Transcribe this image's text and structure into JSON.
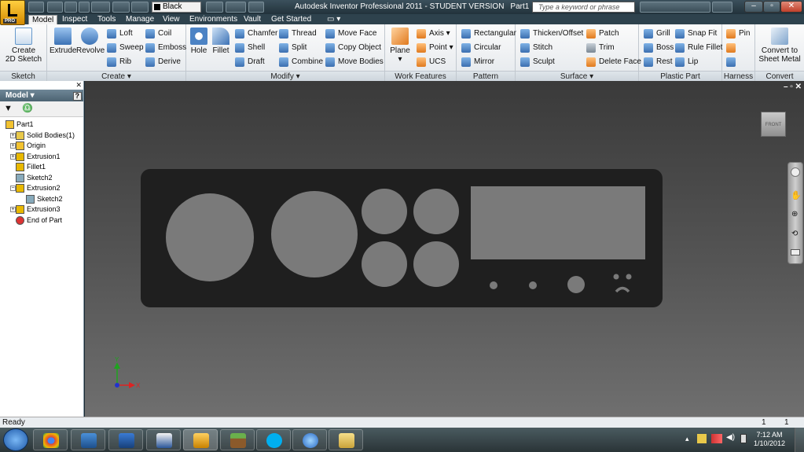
{
  "window": {
    "title": "Autodesk Inventor Professional 2011 - STUDENT VERSION",
    "document": "Part1",
    "app_badge": "PRO",
    "material": "Black",
    "search_placeholder": "Type a keyword or phrase"
  },
  "tabs": [
    "Model",
    "Inspect",
    "Tools",
    "Manage",
    "View",
    "Environments",
    "Vault",
    "Get Started"
  ],
  "ribbon": {
    "sketch": {
      "label": "Sketch",
      "create_line1": "Create",
      "create_line2": "2D Sketch"
    },
    "create": {
      "label": "Create",
      "extrude": "Extrude",
      "revolve": "Revolve",
      "loft": "Loft",
      "sweep": "Sweep",
      "rib": "Rib",
      "coil": "Coil",
      "emboss": "Emboss",
      "derive": "Derive"
    },
    "modify": {
      "label": "Modify",
      "hole": "Hole",
      "fillet": "Fillet",
      "chamfer": "Chamfer",
      "shell": "Shell",
      "draft": "Draft",
      "thread": "Thread",
      "split": "Split",
      "combine": "Combine",
      "move_face": "Move Face",
      "copy_object": "Copy Object",
      "move_bodies": "Move Bodies"
    },
    "work_features": {
      "label": "Work Features",
      "plane": "Plane",
      "axis": "Axis",
      "point": "Point",
      "ucs": "UCS"
    },
    "pattern": {
      "label": "Pattern",
      "rectangular": "Rectangular",
      "circular": "Circular",
      "mirror": "Mirror"
    },
    "surface": {
      "label": "Surface",
      "thicken": "Thicken/Offset",
      "stitch": "Stitch",
      "sculpt": "Sculpt",
      "patch": "Patch",
      "trim": "Trim",
      "delete_face": "Delete Face"
    },
    "plastic": {
      "label": "Plastic Part",
      "grill": "Grill",
      "boss": "Boss",
      "rest": "Rest",
      "snap_fit": "Snap Fit",
      "rule_fillet": "Rule Fillet",
      "lip": "Lip"
    },
    "harness": {
      "label": "Harness",
      "pin": "Pin"
    },
    "convert": {
      "label": "Convert",
      "line1": "Convert to",
      "line2": "Sheet Metal"
    }
  },
  "browser": {
    "title": "Model",
    "help": "?",
    "tree": [
      {
        "label": "Part1",
        "indent": 0
      },
      {
        "label": "Solid Bodies(1)",
        "indent": 1
      },
      {
        "label": "Origin",
        "indent": 1
      },
      {
        "label": "Extrusion1",
        "indent": 1
      },
      {
        "label": "Fillet1",
        "indent": 1
      },
      {
        "label": "Sketch2",
        "indent": 1
      },
      {
        "label": "Extrusion2",
        "indent": 1
      },
      {
        "label": "Sketch2",
        "indent": 2
      },
      {
        "label": "Extrusion3",
        "indent": 1
      },
      {
        "label": "End of Part",
        "indent": 1
      }
    ]
  },
  "viewport": {
    "viewcube_label": "FRONT",
    "axis_x": "X",
    "axis_y": "Y"
  },
  "status": {
    "text": "Ready",
    "count1": "1",
    "count2": "1"
  },
  "taskbar": {
    "time": "7:12 AM",
    "date": "1/10/2012"
  },
  "colors": {
    "accent": "#3b6fb0",
    "part": "#1f1f1f",
    "cutout": "#7a7a7a"
  }
}
